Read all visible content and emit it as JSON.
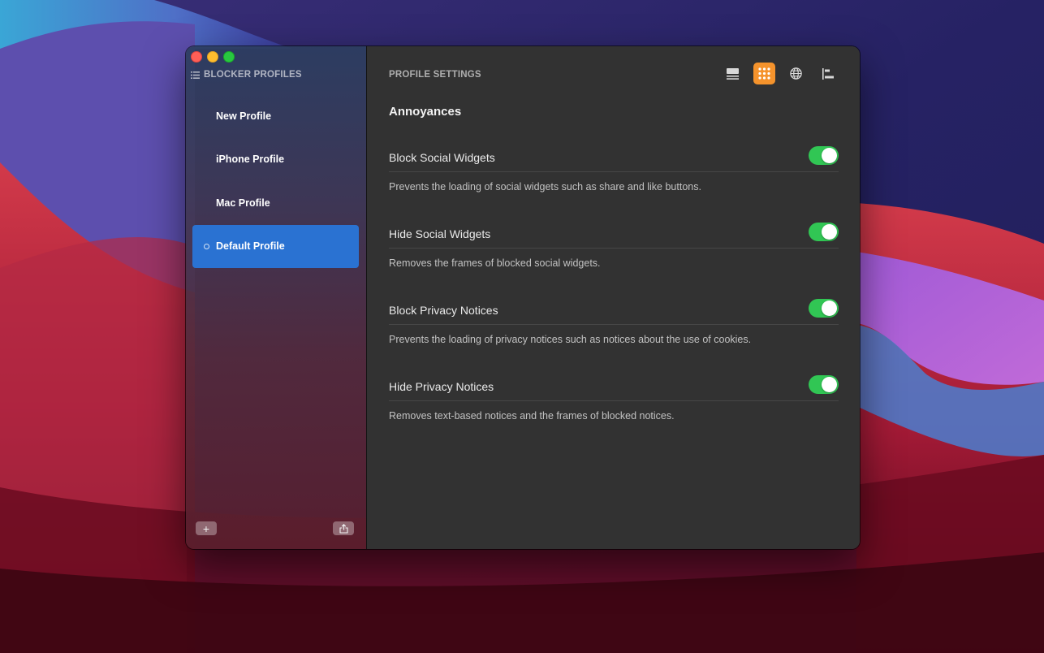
{
  "window": {
    "traffic_lights": [
      "close",
      "minimize",
      "maximize"
    ]
  },
  "sidebar": {
    "header": "BLOCKER PROFILES",
    "header_icon": "list-icon",
    "profiles": [
      {
        "name": "New Profile",
        "selected": false,
        "active": false
      },
      {
        "name": "iPhone Profile",
        "selected": false,
        "active": false
      },
      {
        "name": "Mac Profile",
        "selected": false,
        "active": false
      },
      {
        "name": "Default Profile",
        "selected": true,
        "active": true
      }
    ],
    "add_label": "+",
    "share_icon": "share-icon"
  },
  "main": {
    "header": "PROFILE SETTINGS",
    "toolbar": [
      {
        "icon": "list-view-icon",
        "active": false
      },
      {
        "icon": "grid-icon",
        "active": true
      },
      {
        "icon": "globe-icon",
        "active": false
      },
      {
        "icon": "align-left-icon",
        "active": false
      }
    ],
    "section_title": "Annoyances",
    "settings": [
      {
        "title": "Block Social Widgets",
        "description": "Prevents the loading of social widgets such as share and like buttons.",
        "enabled": true
      },
      {
        "title": "Hide Social Widgets",
        "description": "Removes the frames of blocked social widgets.",
        "enabled": true
      },
      {
        "title": "Block Privacy Notices",
        "description": "Prevents the loading of privacy notices such as notices about the use of cookies.",
        "enabled": true
      },
      {
        "title": "Hide Privacy Notices",
        "description": "Removes text-based notices and the frames of blocked notices.",
        "enabled": true
      }
    ]
  },
  "colors": {
    "accent_orange": "#f5932c",
    "selection_blue": "#2a72d2",
    "toggle_green": "#31c654"
  }
}
